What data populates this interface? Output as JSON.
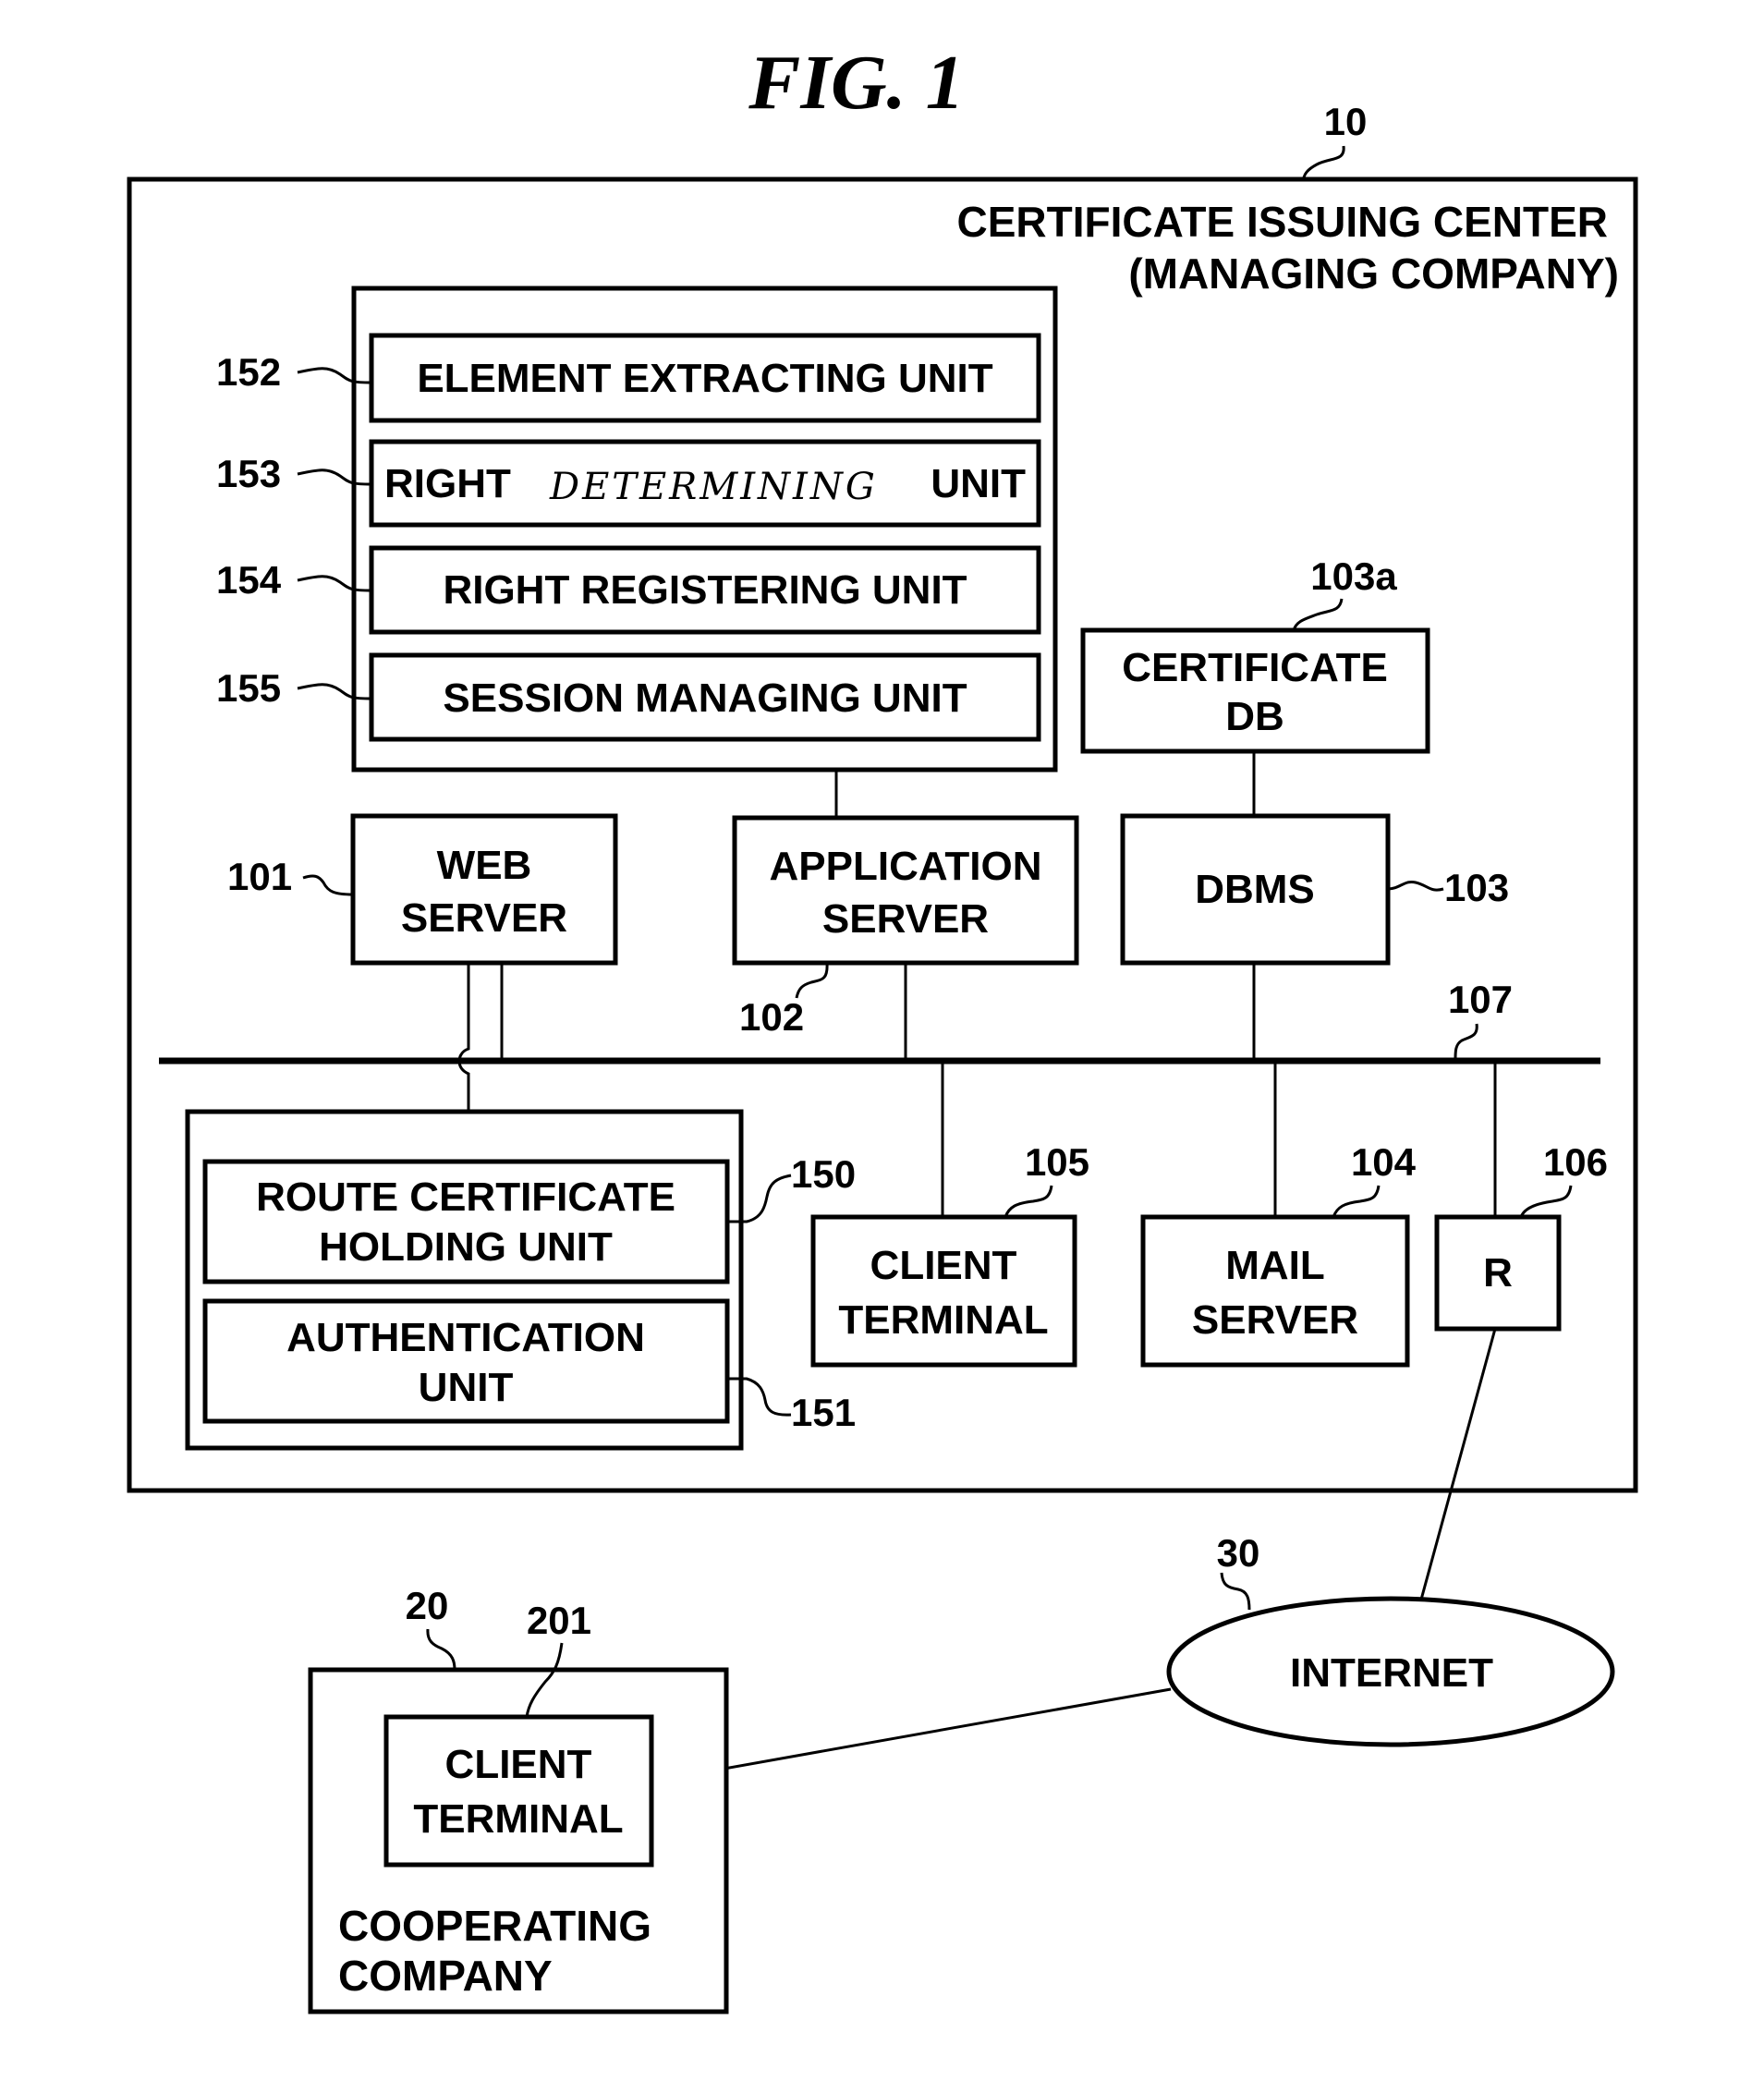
{
  "figure": {
    "title": "FIG. 1"
  },
  "center": {
    "ref": "10",
    "title_line1": "CERTIFICATE ISSUING CENTER",
    "title_line2": "(MANAGING COMPANY)"
  },
  "units": [
    {
      "ref": "152",
      "label": "ELEMENT EXTRACTING UNIT"
    },
    {
      "ref": "153",
      "label_prefix": "RIGHT",
      "label_handwritten": "DETERMINING",
      "label_suffix": "UNIT"
    },
    {
      "ref": "154",
      "label": "RIGHT REGISTERING UNIT"
    },
    {
      "ref": "155",
      "label": "SESSION MANAGING UNIT"
    }
  ],
  "certificate_db": {
    "ref": "103a",
    "line1": "CERTIFICATE",
    "line2": "DB"
  },
  "web_server": {
    "ref": "101",
    "line1": "WEB",
    "line2": "SERVER"
  },
  "application_server": {
    "ref": "102",
    "line1": "APPLICATION",
    "line2": "SERVER"
  },
  "dbms": {
    "ref": "103",
    "label": "DBMS"
  },
  "network": {
    "ref": "107"
  },
  "route_certificate_unit": {
    "ref": "150",
    "line1": "ROUTE CERTIFICATE",
    "line2": "HOLDING UNIT"
  },
  "authentication_unit": {
    "ref": "151",
    "line1": "AUTHENTICATION",
    "line2": "UNIT"
  },
  "client_terminal": {
    "ref": "105",
    "line1": "CLIENT",
    "line2": "TERMINAL"
  },
  "mail_server": {
    "ref": "104",
    "line1": "MAIL",
    "line2": "SERVER"
  },
  "router": {
    "ref": "106",
    "label": "R"
  },
  "internet": {
    "ref": "30",
    "label": "INTERNET"
  },
  "cooperating_company": {
    "ref": "20",
    "line1": "COOPERATING",
    "line2": "COMPANY",
    "client_ref": "201",
    "client_line1": "CLIENT",
    "client_line2": "TERMINAL"
  }
}
